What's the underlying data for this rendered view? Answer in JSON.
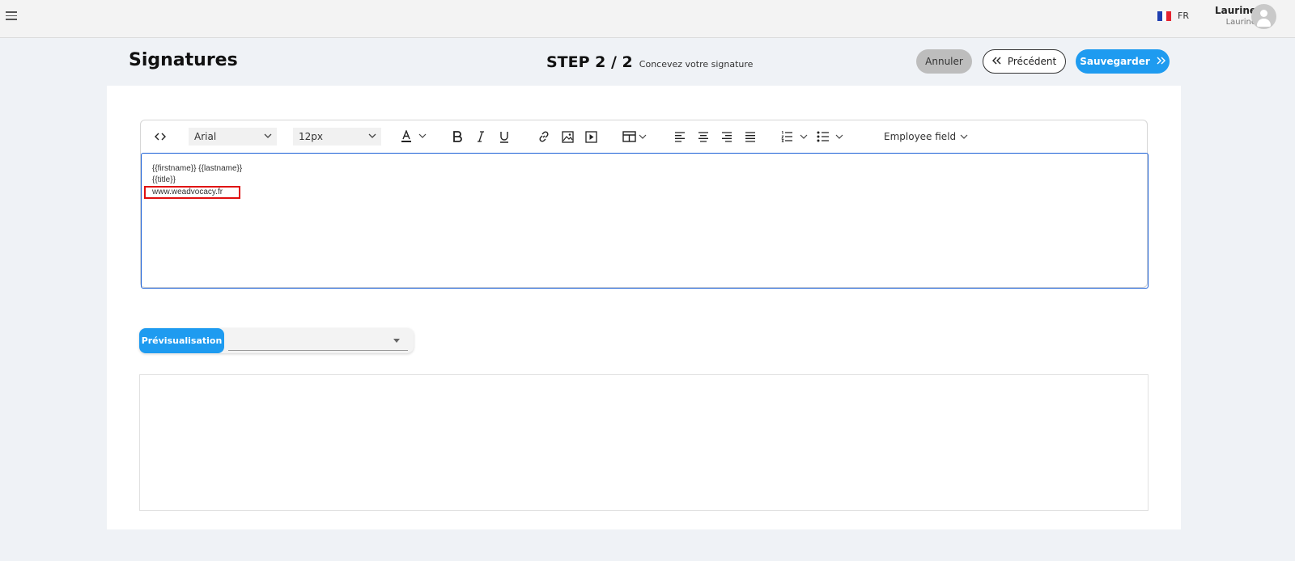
{
  "topbar": {
    "language": "FR",
    "flag_colors": [
      "#1f3fb0",
      "#ffffff",
      "#e52330"
    ],
    "user_name": "Laurine",
    "user_sub": "Laurine"
  },
  "header": {
    "title": "Signatures",
    "step": "STEP 2 / 2",
    "step_caption": "Concevez votre signature",
    "cancel_label": "Annuler",
    "prev_label": "Précédent",
    "save_label": "Sauvegarder"
  },
  "editor": {
    "font_family": "Arial",
    "font_size": "12px",
    "employee_field_label": "Employee field",
    "lines": [
      "{{firstname}} {{lastname}}",
      "{{title}}",
      "www.weadvocacy.fr"
    ]
  },
  "preview": {
    "button_label": "Prévisualisation",
    "selected_value": ""
  },
  "colors": {
    "accent": "#1e9bf0",
    "editor_border": "#1a5fd6",
    "highlight_box": "#e01010"
  }
}
